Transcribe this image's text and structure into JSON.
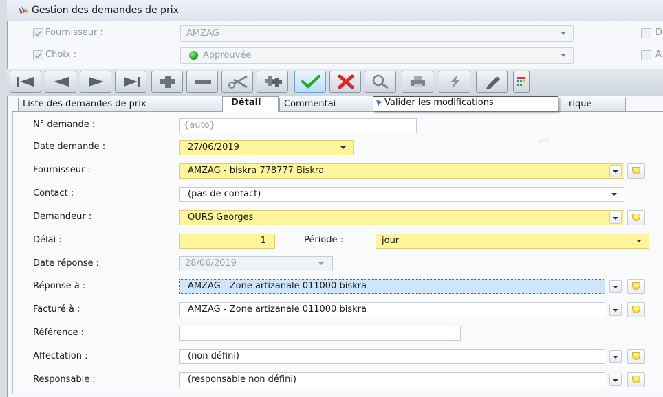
{
  "window": {
    "title": "Gestion des demandes de prix"
  },
  "filters": {
    "fournisseur": {
      "label": "Fournisseur :",
      "value": "AMZAG",
      "right_label": "D"
    },
    "choix": {
      "label": "Choix :",
      "value": "Approuvée",
      "right_label": "A"
    }
  },
  "toolbar": {
    "buttons": [
      "first",
      "previous",
      "next",
      "last",
      "add",
      "remove",
      "cut",
      "duplicate",
      "validate",
      "cancel",
      "search",
      "print",
      "flash",
      "edit",
      "grid"
    ]
  },
  "tabs": [
    "Liste des demandes de prix",
    "Détail",
    "Commentai",
    "rique"
  ],
  "tooltip": "Valider les modifications",
  "form": {
    "num_demande": {
      "label": "N° demande :",
      "value": "{auto}"
    },
    "date_demande": {
      "label": "Date demande :",
      "value": "27/06/2019"
    },
    "fournisseur": {
      "label": "Fournisseur :",
      "value": "AMZAG - biskra 778777 Biskra"
    },
    "contact": {
      "label": "Contact :",
      "value": "(pas de contact)"
    },
    "demandeur": {
      "label": "Demandeur :",
      "value": "OURS Georges"
    },
    "delai": {
      "label": "Délai :",
      "value": "1",
      "periode_label": "Période :",
      "periode_value": "jour"
    },
    "date_reponse": {
      "label": "Date réponse :",
      "value": "28/06/2019"
    },
    "reponse_a": {
      "label": "Réponse à :",
      "value": "AMZAG - Zone artizanale 011000 biskra"
    },
    "facture_a": {
      "label": "Facturé à :",
      "value": "AMZAG - Zone artizanale 011000 biskra"
    },
    "reference": {
      "label": "Référence :",
      "value": ""
    },
    "affectation": {
      "label": "Affectation :",
      "value": "(non défini)"
    },
    "responsable": {
      "label": "Responsable :",
      "value": "(responsable non défini)"
    }
  }
}
